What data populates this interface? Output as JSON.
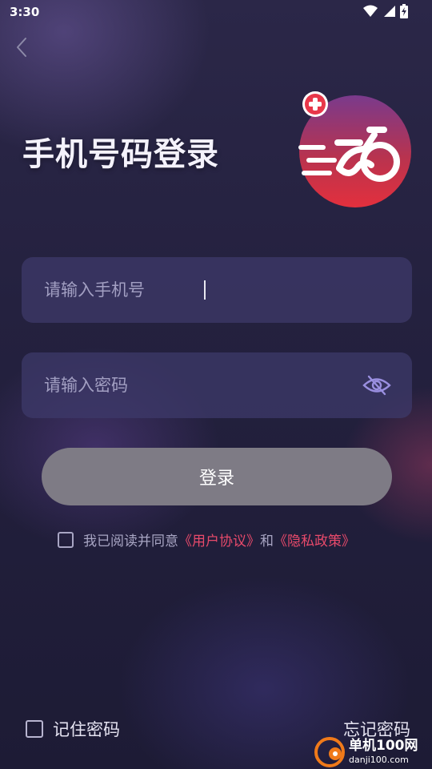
{
  "status_bar": {
    "time": "3:30",
    "icons": [
      "wifi-icon",
      "signal-icon",
      "battery-charging-icon"
    ]
  },
  "header": {
    "back_icon": "chevron-left-icon",
    "title": "手机号码登录"
  },
  "logo": {
    "icon": "bike-logo-icon",
    "colors": {
      "top": "#7a3a8c",
      "bottom": "#e3303d",
      "badge": "#e8374a"
    }
  },
  "form": {
    "phone_placeholder": "请输入手机号",
    "phone_value": "",
    "password_placeholder": "请输入密码",
    "password_value": "",
    "password_toggle_icon": "eye-off-icon",
    "login_label": "登录"
  },
  "agreement": {
    "checked": false,
    "prefix": "我已阅读并同意",
    "user_agreement": "《用户协议》",
    "conjunction": "和",
    "privacy_policy": "《隐私政策》"
  },
  "footer": {
    "remember_label": "记住密码",
    "remember_checked": false,
    "forgot_label": "忘记密码"
  },
  "watermark": {
    "name": "单机100网",
    "url": "danji100.com"
  },
  "colors": {
    "accent_link": "#e84a6b",
    "button_bg": "#7e7b85",
    "field_bg": "#3e3a69"
  }
}
